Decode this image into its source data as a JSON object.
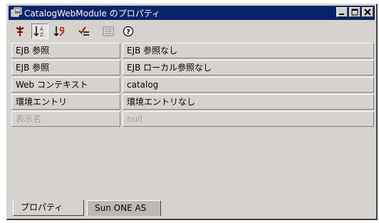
{
  "window": {
    "title": "CatalogWebModule のプロパティ"
  },
  "toolbar": {
    "buttons": [
      {
        "icon": "unsorted-icon"
      },
      {
        "icon": "sort-by-name-icon",
        "pressed": true
      },
      {
        "icon": "sort-by-type-icon"
      },
      {
        "icon": "show-editable-icon"
      },
      {
        "icon": "customize-icon"
      },
      {
        "icon": "help-icon"
      }
    ]
  },
  "properties": [
    {
      "name": "EJB 参照",
      "value": "EJB 参照なし",
      "enabled": true
    },
    {
      "name": "EJB 参照",
      "value": "EJB ローカル参照なし",
      "enabled": true
    },
    {
      "name": "Web コンテキスト",
      "value": "catalog",
      "enabled": true
    },
    {
      "name": "環境エントリ",
      "value": "環境エントリなし",
      "enabled": true
    },
    {
      "name": "表示名",
      "value": "null",
      "enabled": false
    }
  ],
  "tabs": [
    {
      "label": "プロパティ",
      "active": true
    },
    {
      "label": "Sun ONE AS",
      "active": false
    }
  ],
  "colors": {
    "titlebar": "#0a246a",
    "face": "#d6d3ce",
    "disabled_text": "#a0a0a0"
  }
}
